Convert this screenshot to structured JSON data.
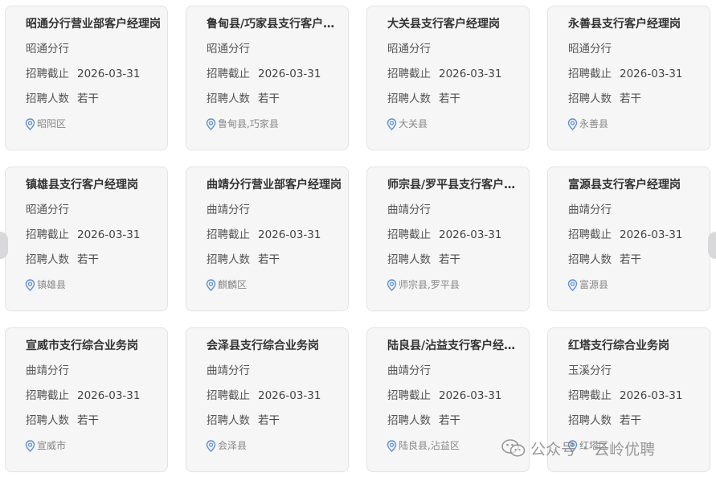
{
  "cards": [
    {
      "title": "昭通分行营业部客户经理岗",
      "branch": "昭通分行",
      "deadline_label": "招聘截止",
      "deadline": "2026-03-31",
      "count_label": "招聘人数",
      "count": "若干",
      "location": "昭阳区"
    },
    {
      "title": "鲁甸县/巧家县支行客户…",
      "branch": "昭通分行",
      "deadline_label": "招聘截止",
      "deadline": "2026-03-31",
      "count_label": "招聘人数",
      "count": "若干",
      "location": "鲁甸县,巧家县"
    },
    {
      "title": "大关县支行客户经理岗",
      "branch": "昭通分行",
      "deadline_label": "招聘截止",
      "deadline": "2026-03-31",
      "count_label": "招聘人数",
      "count": "若干",
      "location": "大关县"
    },
    {
      "title": "永善县支行客户经理岗",
      "branch": "昭通分行",
      "deadline_label": "招聘截止",
      "deadline": "2026-03-31",
      "count_label": "招聘人数",
      "count": "若干",
      "location": "永善县"
    },
    {
      "title": "镇雄县支行客户经理岗",
      "branch": "昭通分行",
      "deadline_label": "招聘截止",
      "deadline": "2026-03-31",
      "count_label": "招聘人数",
      "count": "若干",
      "location": "镇雄县"
    },
    {
      "title": "曲靖分行营业部客户经理岗",
      "branch": "曲靖分行",
      "deadline_label": "招聘截止",
      "deadline": "2026-03-31",
      "count_label": "招聘人数",
      "count": "若干",
      "location": "麒麟区"
    },
    {
      "title": "师宗县/罗平县支行客户…",
      "branch": "曲靖分行",
      "deadline_label": "招聘截止",
      "deadline": "2026-03-31",
      "count_label": "招聘人数",
      "count": "若干",
      "location": "师宗县,罗平县"
    },
    {
      "title": "富源县支行客户经理岗",
      "branch": "曲靖分行",
      "deadline_label": "招聘截止",
      "deadline": "2026-03-31",
      "count_label": "招聘人数",
      "count": "若干",
      "location": "富源县"
    },
    {
      "title": "宣威市支行综合业务岗",
      "branch": "曲靖分行",
      "deadline_label": "招聘截止",
      "deadline": "2026-03-31",
      "count_label": "招聘人数",
      "count": "若干",
      "location": "宣威市"
    },
    {
      "title": "会泽县支行综合业务岗",
      "branch": "曲靖分行",
      "deadline_label": "招聘截止",
      "deadline": "2026-03-31",
      "count_label": "招聘人数",
      "count": "若干",
      "location": "会泽县"
    },
    {
      "title": "陆良县/沾益支行客户经…",
      "branch": "曲靖分行",
      "deadline_label": "招聘截止",
      "deadline": "2026-03-31",
      "count_label": "招聘人数",
      "count": "若干",
      "location": "陆良县,沾益区"
    },
    {
      "title": "红塔支行综合业务岗",
      "branch": "玉溪分行",
      "deadline_label": "招聘截止",
      "deadline": "2026-03-31",
      "count_label": "招聘人数",
      "count": "若干",
      "location": "红塔区"
    }
  ],
  "watermark": {
    "left": "公众号",
    "right": "云岭优聘"
  },
  "colors": {
    "pin": "#5b8fd4",
    "card_bg": "#f6f6f7",
    "card_border": "#e3e3e5"
  },
  "icons": {
    "location": "map-pin-icon",
    "watermark": "wechat-icon",
    "nav_prev": "chevron-left-icon",
    "nav_next": "chevron-right-icon"
  }
}
